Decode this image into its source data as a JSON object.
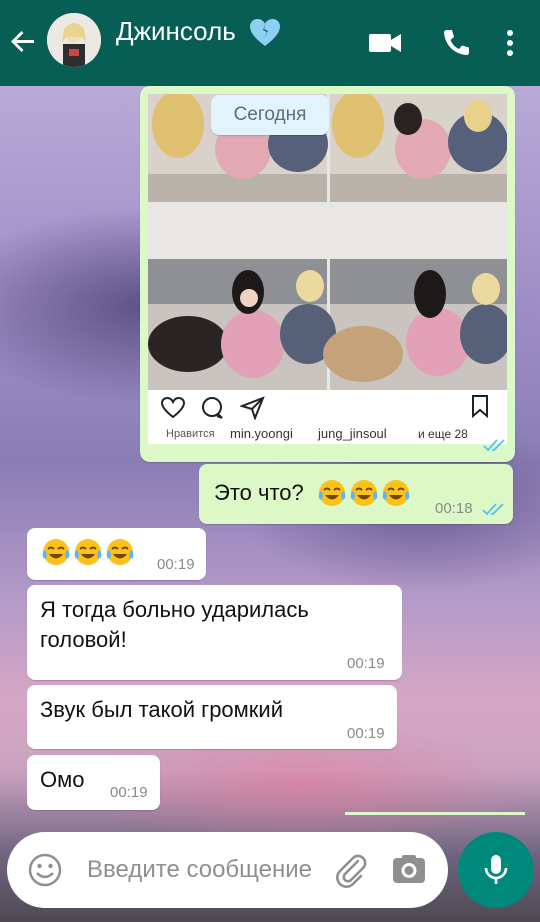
{
  "header": {
    "contact_name": "Джинсоль",
    "heart_color": "#8ed0f2",
    "icons": [
      "back-arrow-icon",
      "video-call-icon",
      "phone-icon",
      "more-vertical-icon"
    ],
    "bar_color": "#075e54"
  },
  "date_chip": "Сегодня",
  "image_message": {
    "insta_likes": "Нравится",
    "insta_user1": "min.yoongi",
    "insta_user2": "jung_jinsoul",
    "insta_more": "и еще 28"
  },
  "messages": [
    {
      "direction": "out",
      "text": "Это что?",
      "emoji_count": 3,
      "time": "00:18",
      "read": true
    },
    {
      "direction": "in",
      "text": "",
      "emoji_count": 3,
      "time": "00:19"
    },
    {
      "direction": "in",
      "text_line1": "Я тогда больно ударилась",
      "text_line2": "головой!",
      "time": "00:19"
    },
    {
      "direction": "in",
      "text": "Звук был такой громкий",
      "time": "00:19"
    },
    {
      "direction": "in",
      "text": "Омо",
      "time": "00:19"
    }
  ],
  "composer": {
    "placeholder": "Введите сообщение",
    "icons": [
      "emoji-icon",
      "attach-icon",
      "camera-icon",
      "mic-icon"
    ]
  },
  "colors": {
    "incoming_bubble": "#ffffff",
    "outgoing_bubble": "#dcf8c6",
    "read_ticks": "#4fc3f7",
    "mic_button": "#00897b"
  }
}
